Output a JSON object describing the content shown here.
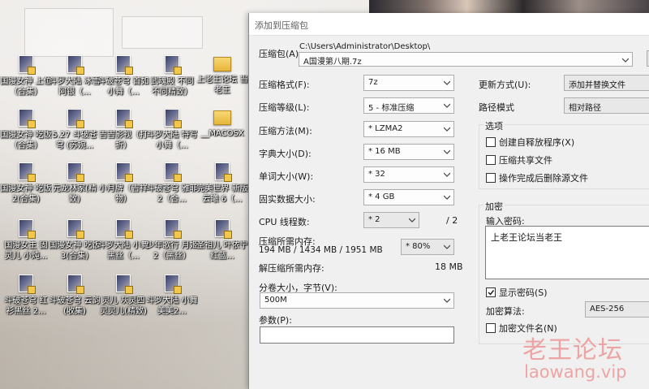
{
  "desktop": {
    "icons": [
      {
        "label": "国漫女神 上位（合集）",
        "type": "video"
      },
      {
        "label": "斗罗大陆 冰雪 阿银（...",
        "type": "video"
      },
      {
        "label": "斗破苍穹 首如 小舞（...",
        "type": "video"
      },
      {
        "label": "武魂殿 不同 不同精致）",
        "type": "video"
      },
      {
        "label": "上老王论坛 当老王",
        "type": "folder"
      },
      {
        "label": "国漫女神 吃饭（合集）",
        "type": "video"
      },
      {
        "label": "5.27 斗破苍穹 (苏婉...",
        "type": "video"
      },
      {
        "label": "吉吉影视（打折）",
        "type": "video"
      },
      {
        "label": "斗罗大陆 特写 小舞（...",
        "type": "video"
      },
      {
        "label": "__MACOSX",
        "type": "folder"
      },
      {
        "label": "国漫女神 吃饭2(合集)",
        "type": "video"
      },
      {
        "label": "元龙林家(精致)",
        "type": "video"
      },
      {
        "label": "小月牌（吉祥物）",
        "type": "video"
      },
      {
        "label": "斗破苍穹 雅菲2（合...",
        "type": "video"
      },
      {
        "label": "完美世界 新版云曦 6（...",
        "type": "video"
      },
      {
        "label": "国漫女主 固 灵儿 小炖...",
        "type": "video"
      },
      {
        "label": "国漫女神 吃饭3(合集)",
        "type": "video"
      },
      {
        "label": "斗罗大陆 小舞黑丝（...",
        "type": "video"
      },
      {
        "label": "少年歌行 月姬2（黑丝）",
        "type": "video"
      },
      {
        "label": "圣祖儿 叶依宁 红蓝...",
        "type": "video"
      },
      {
        "label": "斗破苍穹 红 衫黑丝 2...",
        "type": "video"
      },
      {
        "label": "斗破苍穹 云韵(收集)",
        "type": "video"
      },
      {
        "label": "灵儿 灰灵四 灵灵儿(精致)",
        "type": "video"
      },
      {
        "label": "斗罗大陆 小舞 美美2...",
        "type": "video"
      }
    ]
  },
  "dialog": {
    "title": "添加到压缩包",
    "archive_label": "压缩包(A):",
    "archive_path": "C:\\Users\\Administrator\\Desktop\\",
    "archive_name": "A国漫第八期.7z",
    "format_label": "压缩格式(F):",
    "format_value": "7z",
    "level_label": "压缩等级(L):",
    "level_value": "5 - 标准压缩",
    "method_label": "压缩方法(M):",
    "method_value": "* LZMA2",
    "dict_label": "字典大小(D):",
    "dict_value": "* 16 MB",
    "word_label": "单词大小(W):",
    "word_value": "* 32",
    "solid_label": "固实数据大小:",
    "solid_value": "* 4 GB",
    "threads_label": "CPU 线程数:",
    "threads_value": "* 2",
    "threads_max": "/ 2",
    "mem_comp_label": "压缩所需内存:",
    "mem_comp_value": "194 MB / 1434 MB / 1951 MB",
    "mem_percent": "* 80%",
    "mem_decomp_label": "解压缩所需内存:",
    "mem_decomp_value": "18 MB",
    "split_label": "分卷大小，字节(V):",
    "split_value": "500M",
    "params_label": "参数(P):",
    "params_value": "",
    "update_label": "更新方式(U):",
    "update_value": "添加并替换文件",
    "path_mode_label": "路径模式",
    "path_mode_value": "相对路径",
    "options_title": "选项",
    "opt_sfx": "创建自释放程序(X)",
    "opt_shared": "压缩共享文件",
    "opt_delete": "操作完成后删除源文件",
    "encrypt_title": "加密",
    "password_label": "输入密码:",
    "password_value": "上老王论坛当老王",
    "show_password": "显示密码(S)",
    "enc_method_label": "加密算法:",
    "enc_method_value": "AES-256",
    "encrypt_names": "加密文件名(N)"
  },
  "watermark": {
    "text": "老王论坛",
    "url": "laowang.vip"
  }
}
